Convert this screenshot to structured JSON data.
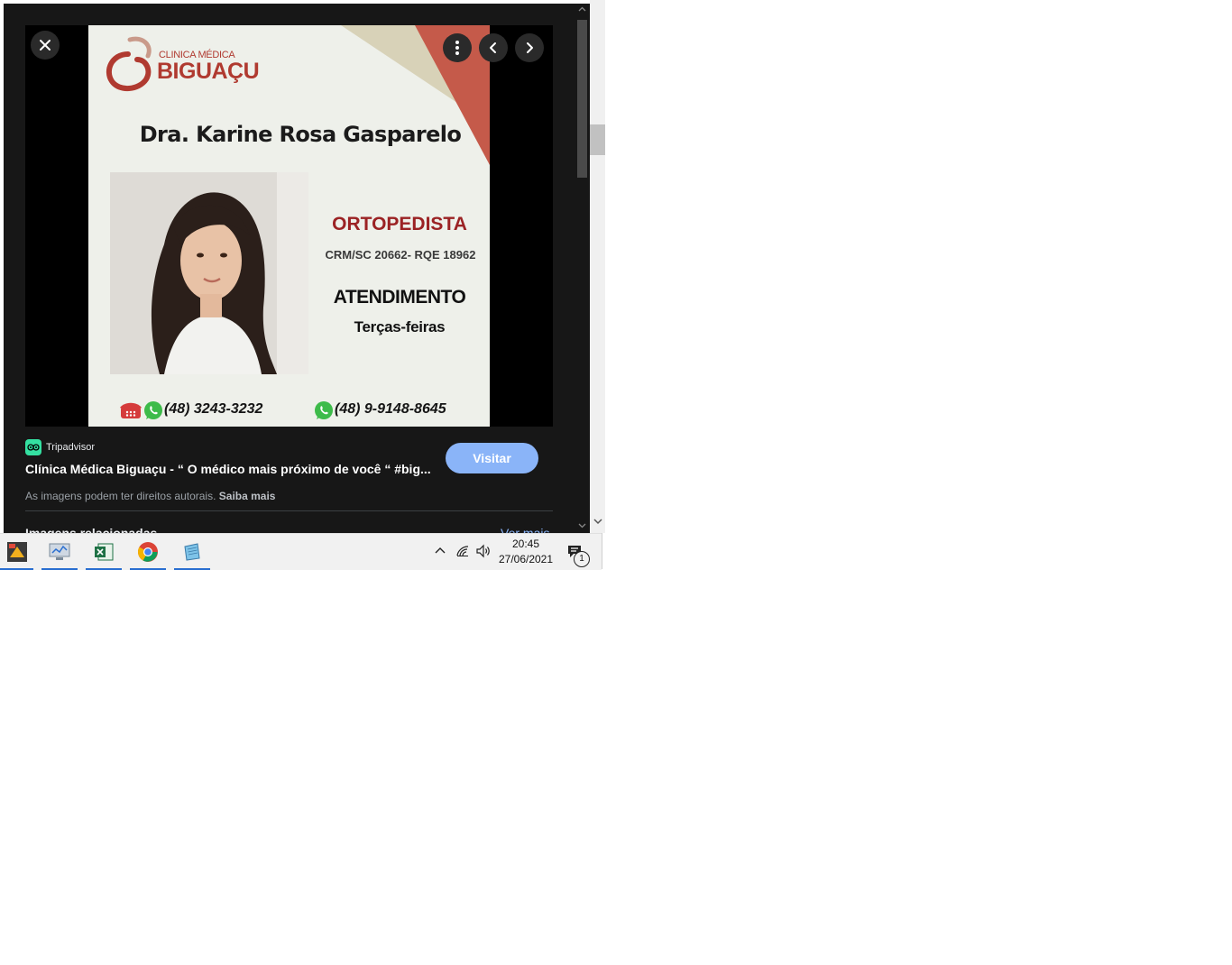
{
  "viewer": {
    "card": {
      "logo": {
        "line1": "CLINICA MÉDICA",
        "line2": "BIGUAÇU"
      },
      "doctor_name": "Dra. Karine Rosa Gasparelo",
      "specialty": "ORTOPEDISTA",
      "crm": "CRM/SC 20662- RQE 18962",
      "attendance_title": "ATENDIMENTO",
      "attendance_days": "Terças-feiras",
      "phone1": "(48) 3243-3232",
      "phone2": "(48) 9-9148-8645"
    },
    "source": {
      "name": "Tripadvisor",
      "icon": "tripadvisor-owl-icon",
      "color": "#34e0a1"
    },
    "result_title": "Clínica Médica Biguaçu - “ O médico mais próximo de você “ #big...",
    "visit_label": "Visitar",
    "copyright_text": "As imagens podem ter direitos autorais.",
    "copyright_link": "Saiba mais",
    "related_label": "Imagens relacionadas",
    "see_more_label": "Ver mais"
  },
  "taskbar": {
    "apps": [
      {
        "name": "paint-app-icon"
      },
      {
        "name": "monitor-app-icon"
      },
      {
        "name": "excel-icon"
      },
      {
        "name": "chrome-icon"
      },
      {
        "name": "notepad-app-icon"
      }
    ],
    "time": "20:45",
    "date": "27/06/2021",
    "notification_count": "1"
  },
  "colors": {
    "accent": "#8ab4f8",
    "brand_red": "#b03a30",
    "viewer_bg": "#171717"
  }
}
